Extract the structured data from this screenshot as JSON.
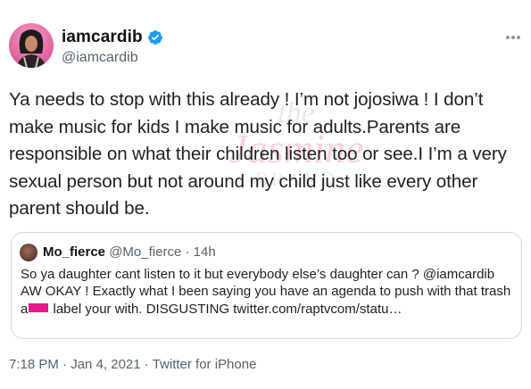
{
  "author": {
    "name": "iamcardib",
    "handle": "@iamcardib",
    "verified_icon": "verified-badge-icon",
    "accent": "#1d9bf0"
  },
  "tweet": {
    "text": "Ya needs to stop with this already ! I’m not jojosiwa ! I don’t make music for kids I make music for adults.Parents are responsible on what their children listen too or see.I I’m a very sexual person but not around my child just like every other parent should be."
  },
  "quoted": {
    "name": "Mo_fierce",
    "handle": "@Mo_fierce",
    "separator": "·",
    "time": "14h",
    "text_before": "So ya daughter cant listen to it but everybody else’s daughter can ? @iamcardib AW OKAY ! Exactly what I been saying you have an agenda to push with that trash a",
    "text_after": " label your with. DISGUSTING twitter.com/raptvcom/statu…",
    "redaction_color": "#e8178a"
  },
  "footer": {
    "time": "7:18 PM",
    "date": "Jan 4, 2021",
    "source": "Twitter for iPhone",
    "separator": "·"
  },
  "watermark": {
    "line1": "the",
    "line2": "Jasmine",
    "line3": "BRAND"
  }
}
